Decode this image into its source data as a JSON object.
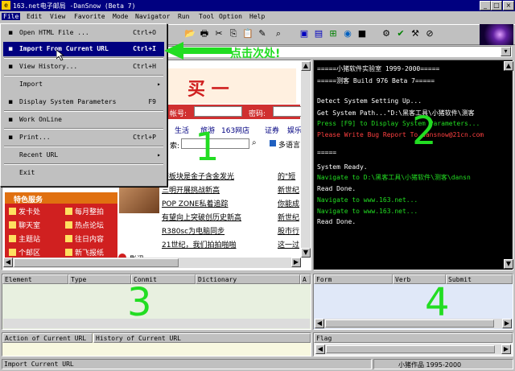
{
  "window": {
    "title": "163.net电子邮局 -DanSnow (Beta 7)"
  },
  "menubar": [
    "File",
    "Edit",
    "View",
    "Favorite",
    "Mode",
    "Navigator",
    "Run",
    "Tool",
    "Option",
    "Help"
  ],
  "file_menu": [
    {
      "label": "Open HTML File ...",
      "shortcut": "Ctrl+O",
      "icon": "open-folder-icon"
    },
    {
      "label": "Import From Current URL",
      "shortcut": "Ctrl+I",
      "icon": "import-icon",
      "highlight": true
    },
    {
      "label": "View History...",
      "shortcut": "Ctrl+H",
      "icon": "history-icon"
    },
    {
      "label": "Import",
      "shortcut": "",
      "icon": "",
      "submenu": true
    },
    {
      "label": "Display System Parameters",
      "shortcut": "F9",
      "icon": "parameters-icon"
    },
    {
      "label": "Work OnLine",
      "shortcut": "",
      "icon": "online-icon"
    },
    {
      "label": "Print...",
      "shortcut": "Ctrl+P",
      "icon": "print-icon"
    },
    {
      "label": "Recent URL",
      "shortcut": "",
      "icon": "",
      "submenu": true
    },
    {
      "label": "Exit",
      "shortcut": "",
      "icon": ""
    }
  ],
  "callout": "点击次处!",
  "console": [
    {
      "text": "=====小猪软件实验室 1999-2000=====",
      "color": "#ffffff"
    },
    {
      "text": "=====测客 Build 976 Beta 7=====",
      "color": "#ffffff"
    },
    {
      "text": "Detect System Setting Up...",
      "color": "#ffffff"
    },
    {
      "text": "Get System Path...\"D:\\黑客工具\\小猪软件\\测客",
      "color": "#ffffff"
    },
    {
      "text": "Press [F9] to Display System Parameters...",
      "color": "#22dd22"
    },
    {
      "text": "Please Write Bug Report To dansnow@21cn.com",
      "color": "#ff4040"
    },
    {
      "text": "=====",
      "color": "#ffffff"
    },
    {
      "text": "System Ready.",
      "color": "#ffffff"
    },
    {
      "text": "Navigate to D:\\黑客工具\\小猪软件\\测客\\dansn",
      "color": "#22dd22"
    },
    {
      "text": "Read Done.",
      "color": "#ffffff"
    },
    {
      "text": "Navigate to www.163.net...",
      "color": "#22dd22"
    },
    {
      "text": "Navigate to www.163.net...",
      "color": "#22dd22"
    },
    {
      "text": "Read Done.",
      "color": "#ffffff"
    }
  ],
  "web": {
    "banner": "买 一",
    "account_label": "帐号:",
    "password_label": "密码:",
    "nav_links": [
      "生活",
      "旅游",
      "163网店",
      "证券",
      "娱乐"
    ],
    "search_label": "索:",
    "multilang": "多语言",
    "news": [
      "药板块是金子含金发光",
      "三明开展挑战新高",
      "POP ZONE私着追踪",
      "有望向上突破创历史新高",
      "R380sc为电脑同步",
      "21世纪，我们拍拍啪啪"
    ],
    "right_links": [
      "的\"短",
      "新世纪",
      "你能成",
      "新世纪",
      "股市行",
      "这一过"
    ],
    "section": "特色服务",
    "services": [
      [
        "发卡处",
        "每月整拍"
      ],
      [
        "聊天室",
        "热点论坛"
      ],
      [
        "主题站",
        "往日内容"
      ],
      [
        "个邮区",
        "新飞报纸"
      ]
    ],
    "bottom_link": "影讯"
  },
  "panel3_headers": [
    "Element",
    "Type",
    "Conmit",
    "Dictionary",
    "A"
  ],
  "panel4_headers": [
    "Form",
    "Verb",
    "Submit"
  ],
  "panel_actions": [
    "Action of Current URL",
    "History of Current URL"
  ],
  "panel_flag": "Flag",
  "status": {
    "left": "Import Current URL",
    "right": "小猪作品 1995-2000"
  },
  "labels": {
    "one": "1",
    "two": "2",
    "three": "3",
    "four": "4"
  }
}
